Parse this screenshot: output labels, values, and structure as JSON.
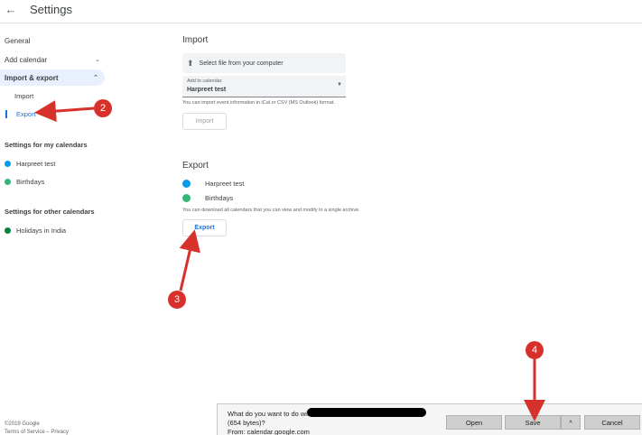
{
  "header": {
    "back_icon": "arrow-back-icon",
    "title": "Settings"
  },
  "sidebar": {
    "general": "General",
    "add_calendar": "Add calendar",
    "import_export": "Import & export",
    "sub_import": "Import",
    "sub_export": "Export",
    "my_cal_heading": "Settings for my calendars",
    "my_calendars": [
      {
        "label": "Harpreet test",
        "color": "#039be5"
      },
      {
        "label": "Birthdays",
        "color": "#33b679"
      }
    ],
    "other_heading": "Settings for other calendars",
    "other_calendars": [
      {
        "label": "Holidays in India",
        "color": "#0b8043"
      }
    ],
    "footer_copyright": "©2019 Google",
    "footer_links": "Terms of Service – Privacy"
  },
  "import": {
    "heading": "Import",
    "select_file": "Select file from your computer",
    "add_to_label": "Add to calendar",
    "add_to_value": "Harpreet test",
    "helper": "You can import event information in iCal or CSV (MS Outlook) format.",
    "button": "Import"
  },
  "export": {
    "heading": "Export",
    "calendars": [
      {
        "label": "Harpreet test",
        "color": "#039be5"
      },
      {
        "label": "Birthdays",
        "color": "#33b679"
      }
    ],
    "helper": "You can download all calendars that you can view and modify in a single archive.",
    "button": "Export"
  },
  "download_bar": {
    "question": "What do you want to do with",
    "size": "(654 bytes)?",
    "from": "From: calendar.google.com",
    "open": "Open",
    "save": "Save",
    "caret": "^",
    "cancel": "Cancel"
  },
  "callouts": [
    "2",
    "3",
    "4"
  ],
  "colors": {
    "accent": "#1a73e8",
    "callout": "#d7312b",
    "active_bg": "#e8f0fe"
  }
}
